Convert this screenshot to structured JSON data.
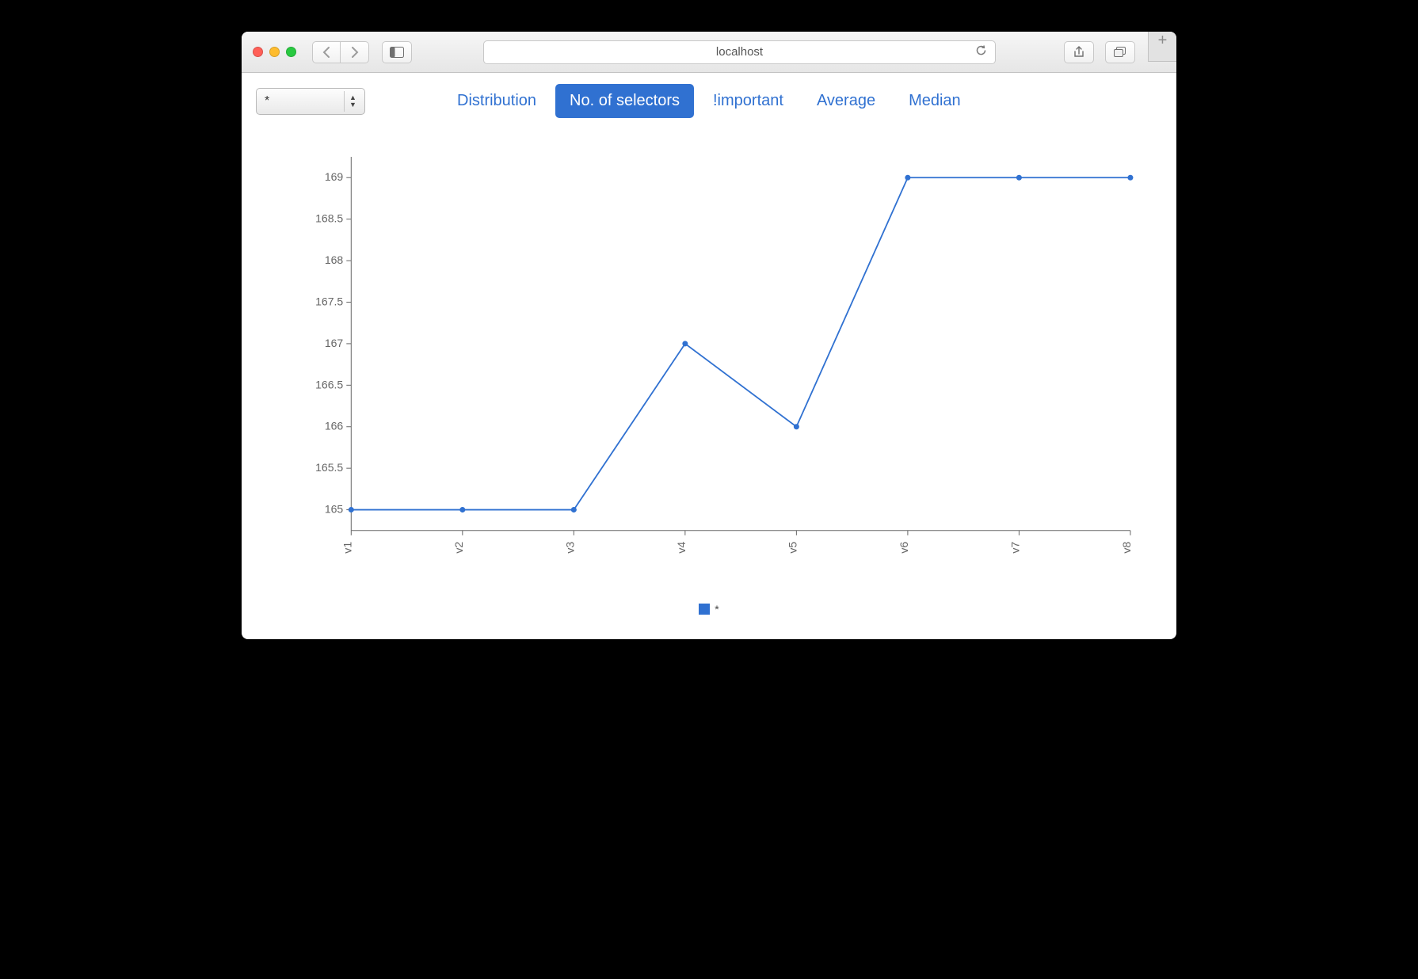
{
  "browser": {
    "url_display": "localhost"
  },
  "toolbar": {
    "selector_value": "*"
  },
  "tabs": [
    {
      "id": "distribution",
      "label": "Distribution",
      "active": false
    },
    {
      "id": "no-of-selectors",
      "label": "No. of selectors",
      "active": true
    },
    {
      "id": "important",
      "label": "!important",
      "active": false
    },
    {
      "id": "average",
      "label": "Average",
      "active": false
    },
    {
      "id": "median",
      "label": "Median",
      "active": false
    }
  ],
  "legend": {
    "series_name": "*"
  },
  "chart_data": {
    "type": "line",
    "series_name": "*",
    "categories": [
      "v1",
      "v2",
      "v3",
      "v4",
      "v5",
      "v6",
      "v7",
      "v8"
    ],
    "values": [
      165,
      165,
      165,
      167,
      166,
      169,
      169,
      169
    ],
    "y_ticks": [
      165,
      165.5,
      166,
      166.5,
      167,
      167.5,
      168,
      168.5,
      169
    ],
    "ylim": [
      164.75,
      169.25
    ],
    "color": "#3071d1",
    "xlabel": "",
    "ylabel": "",
    "title": ""
  }
}
